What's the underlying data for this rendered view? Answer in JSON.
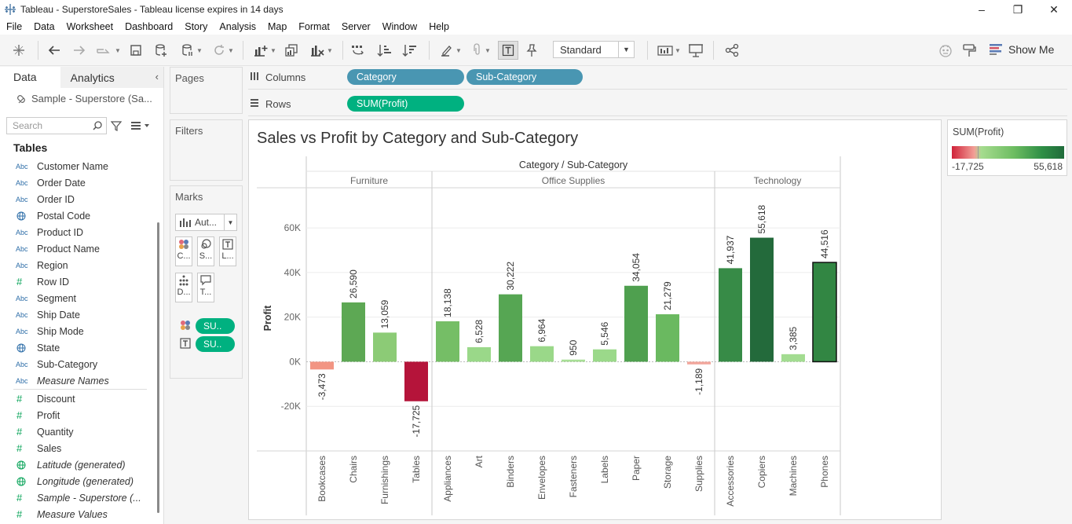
{
  "window": {
    "title": "Tableau - SuperstoreSales - Tableau license expires in 14 days",
    "controls": [
      "–",
      "❐",
      "✕"
    ]
  },
  "menu": [
    "File",
    "Data",
    "Worksheet",
    "Dashboard",
    "Story",
    "Analysis",
    "Map",
    "Format",
    "Server",
    "Window",
    "Help"
  ],
  "toolbar": {
    "fit_select": "Standard",
    "show_me": "Show Me"
  },
  "data_pane": {
    "tab_data": "Data",
    "tab_analytics": "Analytics",
    "datasource": "Sample - Superstore (Sa...",
    "search_placeholder": "Search",
    "tables_header": "Tables",
    "fields": [
      {
        "icon": "Abc",
        "name": "Customer Name",
        "italic": false
      },
      {
        "icon": "Abc",
        "name": "Order Date",
        "italic": false
      },
      {
        "icon": "Abc",
        "name": "Order ID",
        "italic": false
      },
      {
        "icon": "globe",
        "name": "Postal Code",
        "italic": false
      },
      {
        "icon": "Abc",
        "name": "Product ID",
        "italic": false
      },
      {
        "icon": "Abc",
        "name": "Product Name",
        "italic": false
      },
      {
        "icon": "Abc",
        "name": "Region",
        "italic": false
      },
      {
        "icon": "#",
        "name": "Row ID",
        "italic": false
      },
      {
        "icon": "Abc",
        "name": "Segment",
        "italic": false
      },
      {
        "icon": "Abc",
        "name": "Ship Date",
        "italic": false
      },
      {
        "icon": "Abc",
        "name": "Ship Mode",
        "italic": false
      },
      {
        "icon": "globe",
        "name": "State",
        "italic": false
      },
      {
        "icon": "Abc",
        "name": "Sub-Category",
        "italic": false
      },
      {
        "icon": "Abc",
        "name": "Measure Names",
        "italic": true
      },
      {
        "icon": "#",
        "name": "Discount",
        "italic": false
      },
      {
        "icon": "#",
        "name": "Profit",
        "italic": false
      },
      {
        "icon": "#",
        "name": "Quantity",
        "italic": false
      },
      {
        "icon": "#",
        "name": "Sales",
        "italic": false
      },
      {
        "icon": "globe",
        "name": "Latitude (generated)",
        "italic": true
      },
      {
        "icon": "globe",
        "name": "Longitude (generated)",
        "italic": true
      },
      {
        "icon": "#",
        "name": "Sample - Superstore (...",
        "italic": true
      },
      {
        "icon": "#",
        "name": "Measure Values",
        "italic": true
      }
    ]
  },
  "cards": {
    "pages": "Pages",
    "filters": "Filters",
    "marks": "Marks",
    "mark_type": "Aut...",
    "mark_buttons": [
      "C...",
      "S...",
      "L...",
      "D...",
      "T..."
    ],
    "mark_pills": [
      "SU..",
      "SU.."
    ]
  },
  "shelves": {
    "columns_label": "Columns",
    "rows_label": "Rows",
    "columns_pills": [
      "Category",
      "Sub-Category"
    ],
    "rows_pills": [
      "SUM(Profit)"
    ]
  },
  "legend": {
    "title": "SUM(Profit)",
    "min": "-17,725",
    "max": "55,618"
  },
  "chart_data": {
    "type": "bar",
    "title": "Sales vs Profit by Category and Sub-Category",
    "header": "Category / Sub-Category",
    "ylabel": "Profit",
    "ylim": [
      -40000,
      78000
    ],
    "yticks": [
      -20000,
      0,
      20000,
      40000,
      60000
    ],
    "ytick_labels": [
      "-20K",
      "0K",
      "20K",
      "40K",
      "60K"
    ],
    "groups": [
      {
        "name": "Furniture",
        "categories": [
          "Bookcases",
          "Chairs",
          "Furnishings",
          "Tables"
        ],
        "values": [
          -3473,
          26590,
          13059,
          -17725
        ],
        "labels": [
          "-3,473",
          "26,590",
          "13,059",
          "-17,725"
        ],
        "colors": [
          "#f29583",
          "#5da854",
          "#8ccb76",
          "#b5143a"
        ]
      },
      {
        "name": "Office Supplies",
        "categories": [
          "Appliances",
          "Art",
          "Binders",
          "Envelopes",
          "Fasteners",
          "Labels",
          "Paper",
          "Storage",
          "Supplies"
        ],
        "values": [
          18138,
          6528,
          30222,
          6964,
          950,
          5546,
          34054,
          21279,
          -1189
        ],
        "labels": [
          "18,138",
          "6,528",
          "30,222",
          "6,964",
          "950",
          "5,546",
          "34,054",
          "21,279",
          "-1,189"
        ],
        "colors": [
          "#75be66",
          "#9ad889",
          "#56a653",
          "#9ad889",
          "#a8df96",
          "#9bd98a",
          "#4fa04f",
          "#6ab960",
          "#f2a69c"
        ]
      },
      {
        "name": "Technology",
        "categories": [
          "Accessories",
          "Copiers",
          "Machines",
          "Phones"
        ],
        "values": [
          41937,
          55618,
          3385,
          44516
        ],
        "labels": [
          "41,937",
          "55,618",
          "3,385",
          "44,516"
        ],
        "colors": [
          "#378b47",
          "#236a3b",
          "#a3dc91",
          "#328643"
        ]
      }
    ],
    "selected": "Phones",
    "grid": true
  }
}
